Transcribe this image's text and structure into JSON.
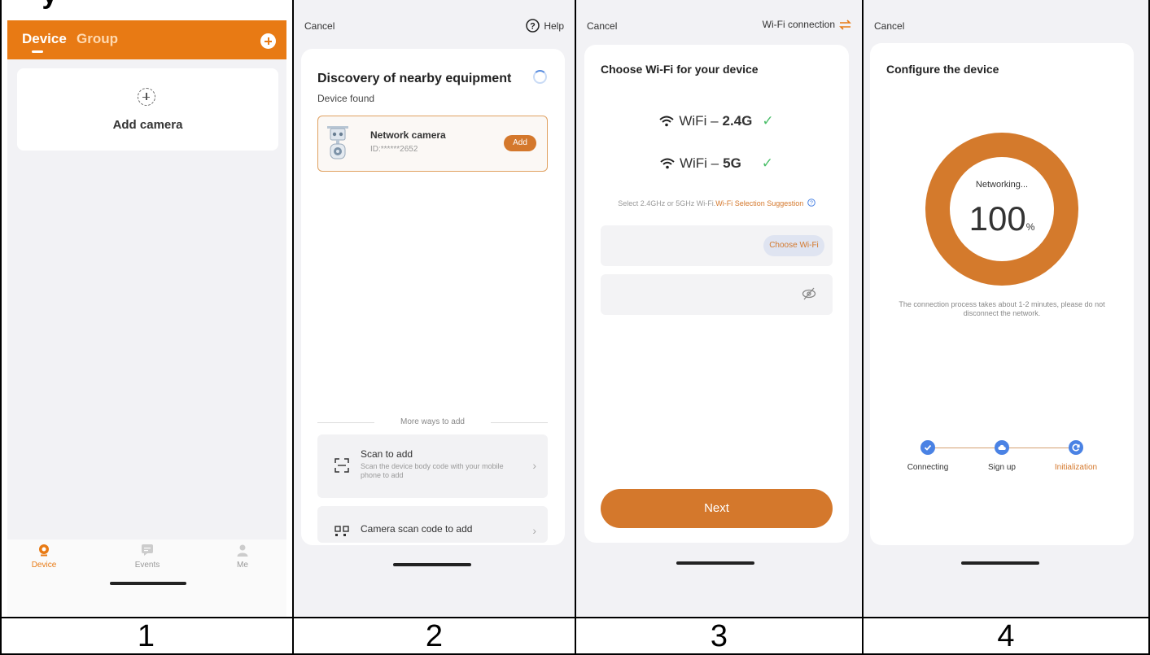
{
  "screen1": {
    "tabs": {
      "device": "Device",
      "group": "Group"
    },
    "add_camera": "Add camera",
    "nav": {
      "device": "Device",
      "events": "Events",
      "me": "Me"
    }
  },
  "screen2": {
    "cancel": "Cancel",
    "help": "Help",
    "title": "Discovery of nearby equipment",
    "found": "Device found",
    "device_name": "Network camera",
    "device_id": "ID:******2652",
    "add_button": "Add",
    "more_ways": "More ways to add",
    "scan_title": "Scan to add",
    "scan_sub": "Scan the device body code with your mobile phone to add",
    "camera_scan_title": "Camera scan code to add"
  },
  "screen3": {
    "cancel": "Cancel",
    "wifi_connection": "Wi-Fi connection",
    "title": "Choose Wi-Fi for your device",
    "wifi_24_prefix": "WiFi –",
    "wifi_24_band": "2.4G",
    "wifi_5_prefix": "WiFi –",
    "wifi_5_band": "5G",
    "hint": "Select 2.4GHz or 5GHz Wi-Fi.",
    "hint_link": "Wi-Fi Selection Suggestion",
    "choose_wifi": "Choose Wi-Fi",
    "next": "Next"
  },
  "screen4": {
    "cancel": "Cancel",
    "title": "Configure the device",
    "networking": "Networking...",
    "progress_value": "100",
    "progress_unit": "%",
    "note": "The connection process takes about 1-2 minutes, please do not disconnect the network.",
    "steps": [
      "Connecting",
      "Sign up",
      "Initialization"
    ]
  },
  "panel_numbers": [
    "1",
    "2",
    "3",
    "4"
  ],
  "colors": {
    "accent": "#e87a14",
    "button": "#d4782c",
    "step_blue": "#4a82e4",
    "check_green": "#4cbf6a"
  }
}
